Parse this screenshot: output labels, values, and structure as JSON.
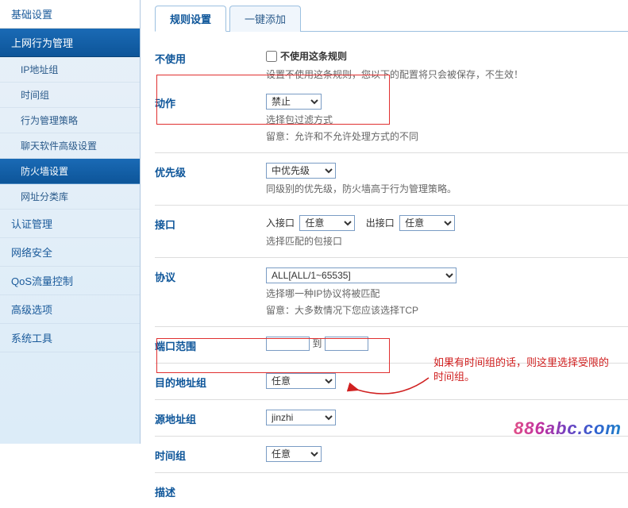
{
  "sidebar": {
    "basic": "基础设置",
    "section": "上网行为管理",
    "items": [
      {
        "label": "IP地址组"
      },
      {
        "label": "时间组"
      },
      {
        "label": "行为管理策略"
      },
      {
        "label": "聊天软件高级设置"
      },
      {
        "label": "防火墙设置"
      },
      {
        "label": "网址分类库"
      }
    ],
    "cats": [
      {
        "label": "认证管理"
      },
      {
        "label": "网络安全"
      },
      {
        "label": "QoS流量控制"
      },
      {
        "label": "高级选项"
      },
      {
        "label": "系统工具"
      }
    ]
  },
  "tabs": {
    "rule": "规则设置",
    "quick": "一键添加"
  },
  "form": {
    "disable": {
      "label": "不使用",
      "checkbox": "不使用这条规则",
      "hint": "设置不使用这条规则，您以下的配置将只会被保存，不生效！"
    },
    "action": {
      "label": "动作",
      "value": "禁止",
      "hint1": "选择包过滤方式",
      "hint2": "留意：允许和不允许处理方式的不同"
    },
    "priority": {
      "label": "优先级",
      "value": "中优先级",
      "hint": "同级别的优先级，防火墙高于行为管理策略。"
    },
    "interface": {
      "label": "接口",
      "in_label": "入接口",
      "in_value": "任意",
      "out_label": "出接口",
      "out_value": "任意",
      "hint": "选择匹配的包接口"
    },
    "protocol": {
      "label": "协议",
      "value": "ALL[ALL/1~65535]",
      "hint1": "选择哪一种IP协议将被匹配",
      "hint2": "留意：大多数情况下您应该选择TCP"
    },
    "port": {
      "label": "端口范围",
      "to": "到"
    },
    "dest": {
      "label": "目的地址组",
      "value": "任意"
    },
    "src": {
      "label": "源地址组",
      "value": "jinzhi"
    },
    "time": {
      "label": "时间组",
      "value": "任意"
    },
    "desc": {
      "label": "描述"
    }
  },
  "annotation": "如果有时间组的话，则这里选择受限的时间组。",
  "watermark": "886abc.com"
}
